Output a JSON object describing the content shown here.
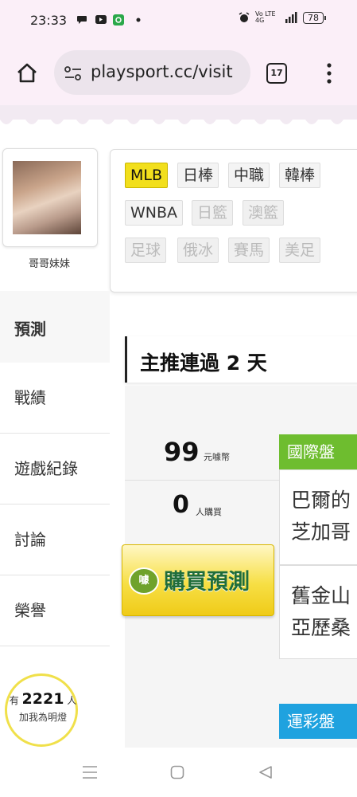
{
  "status_bar": {
    "time": "23:33",
    "network": "Vo LTE 4G",
    "battery": "78",
    "icons": [
      "chat-icon",
      "youtube-icon",
      "app-icon",
      "dot-icon",
      "alarm-icon",
      "signal-icon",
      "battery-icon"
    ]
  },
  "browser": {
    "url": "playsport.cc/visit",
    "tab_count": "17",
    "icons": [
      "home-icon",
      "site-settings-icon",
      "tabs-icon",
      "more-icon"
    ]
  },
  "profile": {
    "name": "哥哥妹妹"
  },
  "tags": {
    "row1": [
      "MLB",
      "日棒",
      "中職",
      "韓棒"
    ],
    "row2": [
      "WNBA",
      "日籃",
      "澳籃"
    ],
    "row3": [
      "足球",
      "俄冰",
      "賽馬",
      "美足"
    ],
    "active": "MLB"
  },
  "menu": {
    "items": [
      "預測",
      "戰績",
      "遊戲紀錄",
      "討論",
      "榮譽"
    ]
  },
  "headline": "主推連過 2 天",
  "prediction": {
    "price": "99",
    "price_unit": "元噱幣",
    "buyers": "0",
    "buyers_unit": "人購買",
    "buy_label": "購買預測",
    "buy_icon_text": "噱"
  },
  "categories": {
    "intl": "國際盤",
    "lottery": "運彩盤"
  },
  "games": [
    [
      "巴爾的",
      "芝加哥"
    ],
    [
      "舊金山",
      "亞歷桑"
    ]
  ],
  "light_badge": {
    "prefix": "有",
    "count": "2221",
    "suffix": "人",
    "label": "加我為明燈"
  },
  "nav": {
    "icons": [
      "recents-icon",
      "home-nav-icon",
      "back-icon"
    ]
  },
  "colors": {
    "status_bg": "#fbeff8",
    "active_tag": "#f2df1c",
    "intl_green": "#6ebd2f",
    "lottery_blue": "#1fa2df",
    "buy_button": "#f7df45",
    "buy_text": "#1f6d3a"
  }
}
